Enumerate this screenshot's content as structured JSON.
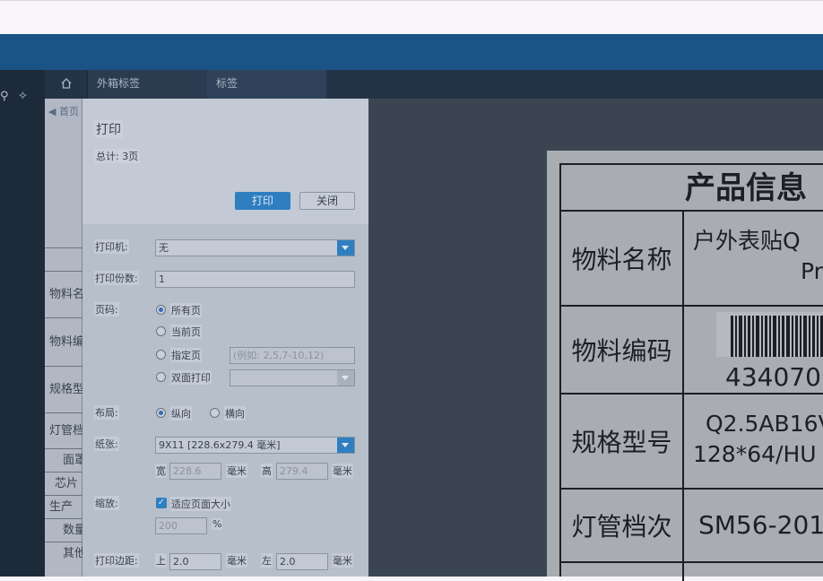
{
  "tabs": {
    "home_icon": "home-icon",
    "tab1": "外箱标签",
    "tab2": "标签"
  },
  "left_table": {
    "home_link": "◀ 首页",
    "rows": [
      "物料名",
      "物料编",
      "规格型",
      "灯管档",
      "面罩",
      "芯片",
      "生产",
      "数量",
      "其他"
    ]
  },
  "dialog": {
    "title": "打印",
    "total": "总计: 3页",
    "print_button": "打印",
    "close_button": "关闭",
    "printer_label": "打印机:",
    "printer_value": "无",
    "copies_label": "打印份数:",
    "copies_value": "1",
    "pages_label": "页码:",
    "page_options": [
      "所有页",
      "当前页",
      "指定页",
      "双面打印"
    ],
    "specify_placeholder": "(例如: 2,5,7-10,12)",
    "layout_label": "布局:",
    "layout_options": [
      "纵向",
      "横向"
    ],
    "paper_label": "纸张:",
    "paper_value": "9X11 [228.6x279.4 毫米]",
    "width_label": "宽",
    "width_value": "228.6",
    "height_label": "高",
    "height_value": "279.4",
    "mm": "毫米",
    "scale_label": "缩放:",
    "fit_page": "适应页面大小",
    "scale_value": "200",
    "percent": "%",
    "margin_label": "打印边距:",
    "margin_top_label": "上",
    "margin_top_value": "2.0",
    "margin_left_label": "左",
    "margin_left_value": "2.0"
  },
  "label_preview": {
    "title": "产品信息",
    "rows": [
      {
        "label": "物料名称",
        "value_line1": "户外表贴Q",
        "value_line2": "Pr"
      },
      {
        "label": "物料编码",
        "value_line1": "434070"
      },
      {
        "label": "规格型号",
        "value_line1": "Q2.5AB16V",
        "value_line2": "128*64/HU"
      },
      {
        "label": "灯管档次",
        "value_line1": "SM56-201"
      }
    ]
  }
}
